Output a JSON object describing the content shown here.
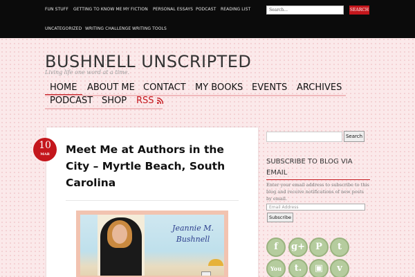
{
  "topnav": {
    "items": [
      "FUN STUFF",
      "GETTING TO KNOW ME",
      "MY FICTION",
      "PERSONAL ESSAYS",
      "PODCAST",
      "READING LIST",
      "UNCATEGORIZED",
      "WRITING CHALLENGE",
      "WRITING TOOLS"
    ],
    "search_placeholder": "Search...",
    "search_button": "SEARCH"
  },
  "header": {
    "title": "BUSHNELL UNSCRIPTED",
    "tagline": "Living life one word at a time."
  },
  "mainmenu": {
    "items": [
      "HOME",
      "ABOUT ME",
      "CONTACT",
      "MY BOOKS",
      "EVENTS",
      "ARCHIVES",
      "PODCAST",
      "SHOP",
      "RSS"
    ],
    "rss_icon": "rss-icon"
  },
  "post": {
    "date_day": "10",
    "date_month": "MAR",
    "title": "Meet Me at Authors in the City – Myrtle Beach, South Carolina",
    "image_text": "Jeannie M. Bushnell"
  },
  "sidebar": {
    "search_button": "Search",
    "subscribe_heading": "SUBSCRIBE TO BLOG VIA EMAIL",
    "subscribe_desc": "Enter your email address to subscribe to this blog and receive notifications of new posts by email.",
    "email_placeholder": "Email Address",
    "subscribe_button": "Subscribe",
    "social": [
      {
        "name": "facebook-icon",
        "glyph": "f"
      },
      {
        "name": "google-plus-icon",
        "glyph": "g+"
      },
      {
        "name": "pinterest-icon",
        "glyph": "P"
      },
      {
        "name": "twitter-icon",
        "glyph": "t"
      },
      {
        "name": "youtube-icon",
        "glyph": "You"
      },
      {
        "name": "tumblr-icon",
        "glyph": "t."
      },
      {
        "name": "instagram-icon",
        "glyph": "▣"
      },
      {
        "name": "vine-icon",
        "glyph": "v"
      }
    ]
  },
  "colors": {
    "accent": "#c4161c",
    "background": "#fbe9ea",
    "topbar": "#0b0b0b",
    "social_green": "#b5cc9e"
  }
}
